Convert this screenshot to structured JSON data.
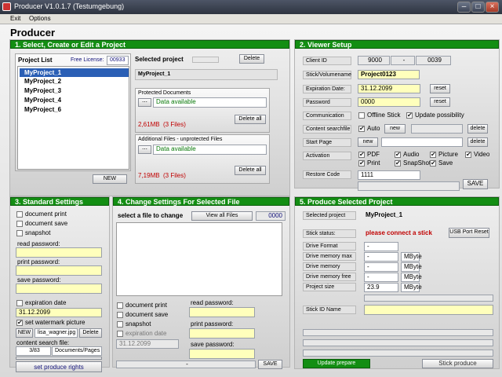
{
  "window": {
    "title": "Producer V1.0.1.7   (Testumgebung)"
  },
  "menu": [
    "Exit",
    "Options"
  ],
  "app_title": "Producer",
  "p1": {
    "title": "1. Select, Create or Edit a Project",
    "list_title": "Project List",
    "free_license": "Free License:",
    "free_count": "00933",
    "projects": [
      "MyProject_1",
      "MyProject_2",
      "MyProject_3",
      "MyProject_4",
      "MyProject_6"
    ],
    "new": "NEW",
    "selected_title": "Selected project",
    "delete": "Delete",
    "selected_name": "MyProject_1",
    "prot_title": "Protected Documents",
    "prot_status": "Data available",
    "prot_size": "2,61MB",
    "prot_files": "(3 Files)",
    "delete_all": "Delete all",
    "add_title": "Additional Files - unprotected Files",
    "add_status": "Data available",
    "add_size": "7,19MB",
    "add_files": "(3 Files)"
  },
  "p2": {
    "title": "2. Viewer Setup",
    "client_id": "Client ID",
    "client_a": "9000",
    "client_sep": "-",
    "client_b": "0039",
    "stick": "Stick/Volumename",
    "stick_val": "Project0123",
    "exp": "Expiration Date:",
    "exp_val": "31.12.2099",
    "reset": "reset",
    "pw": "Password",
    "pw_val": "0000",
    "comm": "Communication",
    "offline": "Offline Stick",
    "update": "Update possibility",
    "csf": "Content searchfile",
    "auto": "Auto",
    "new": "new",
    "delete": "delete",
    "start": "Start Page",
    "act": "Activation",
    "pdf": "PDF",
    "audio": "Audio",
    "picture": "Picture",
    "video": "Video",
    "print": "Print",
    "snapshot": "SnapShot",
    "save": "Save",
    "restore": "Restore Code",
    "restore_val": "1111",
    "save_btn": "SAVE"
  },
  "p3": {
    "title": "3. Standard Settings",
    "doc_print": "document print",
    "doc_save": "document save",
    "snapshot": "snapshot",
    "read_pw": "read password:",
    "print_pw": "print password:",
    "save_pw": "save password:",
    "exp_date": "expiration date",
    "exp_val": "31.12.2099",
    "watermark": "set watermark picture",
    "new": "NEW",
    "wm_file": "lisa_wagner.jpg",
    "delete": "Delete",
    "csf": "content search file:",
    "csf_val": "3/83",
    "csf_type": "Documents/Pages",
    "produce_rights": "set produce rights"
  },
  "p4": {
    "title": "4. Change Settings For Selected File",
    "select": "select a file to change",
    "view_all": "View all Files",
    "count": "0000",
    "doc_print": "document print",
    "doc_save": "document save",
    "snapshot": "snapshot",
    "exp_date": "expiration date",
    "exp_val": "31.12.2099",
    "read_pw": "read password:",
    "print_pw": "print password:",
    "save_pw": "save password:",
    "dash": "-",
    "save": "SAVE"
  },
  "p5": {
    "title": "5. Produce Selected Project",
    "sel": "Selected project",
    "sel_val": "MyProject_1",
    "status": "Stick status:",
    "status_val": "please connect a stick",
    "usb_reset": "USB Port Reset",
    "fmt": "Drive Format",
    "mem_max": "Drive memory max",
    "mem": "Drive memory",
    "mem_free": "Drive memory free",
    "size": "Project size",
    "dash": "-",
    "mbyte": "MByte",
    "size_val": "23.9",
    "stick_id": "Stick ID Name",
    "update_prepare": "Update prepare",
    "stick_produce": "Stick produce"
  }
}
